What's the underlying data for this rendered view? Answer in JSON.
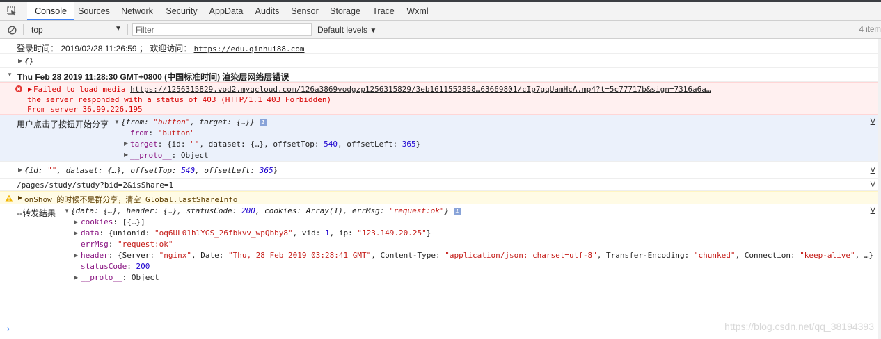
{
  "tabs": [
    "Console",
    "Sources",
    "Network",
    "Security",
    "AppData",
    "Audits",
    "Sensor",
    "Storage",
    "Trace",
    "Wxml"
  ],
  "toolbar": {
    "context": "top",
    "filter_placeholder": "Filter",
    "levels": "Default levels",
    "items_count": "4 item"
  },
  "logs": {
    "login": {
      "text": "登录时间：  2019/02/28 11:26:59 ；  欢迎访问：  ",
      "url": "https://edu.qinhui88.com"
    },
    "empty_obj": "{}",
    "group_header": "Thu Feb 28 2019 11:28:30 GMT+0800 (中国标准时间) 渲染层网络层错误",
    "error": {
      "line1_prefix": "Failed to load media ",
      "line1_url": "https://1256315829.vod2.myqcloud.com/126a3869vodgzp1256315829/3eb1611552858…63669801/cIp7gqUamHcA.mp4?t=5c77717b&sign=7316a6a…",
      "line2": "the server responded with a status of 403 (HTTP/1.1 403 Forbidden)",
      "line3": "From server 36.99.226.195"
    },
    "share_click": {
      "label": "用户点击了按钮开始分享",
      "obj_open": "{from: ",
      "obj_from_val": "\"button\"",
      "obj_mid": ", target: {…}}",
      "from_key": "from",
      "from_val": "\"button\"",
      "target_key": "target",
      "target_pre": ": {id: ",
      "target_id": "\"\"",
      "target_mid": ", dataset: {…}, offsetTop: ",
      "target_top": "540",
      "target_mid2": ", offsetLeft: ",
      "target_left": "365",
      "target_end": "}",
      "proto_key": "__proto__",
      "proto_val": ": Object"
    },
    "target_obj": {
      "pre": "{id: ",
      "id": "\"\"",
      "mid": ", dataset: {…}, offsetTop: ",
      "top": "540",
      "mid2": ", offsetLeft: ",
      "left": "365",
      "end": "}"
    },
    "path": "/pages/study/study?bid=2&isShare=1",
    "warn": {
      "text": "onShow 的时候不是群分享，清空 Global.lastShareInfo"
    },
    "forward": {
      "label": "--转发结果",
      "summary_pre": "{data: {…}, header: {…}, statusCode: ",
      "summary_code": "200",
      "summary_mid": ", cookies: Array(1), errMsg: ",
      "summary_msg": "\"request:ok\"",
      "summary_end": "}",
      "cookies_key": "cookies",
      "cookies_val": ": [{…}]",
      "data_key": "data",
      "data_pre": ": {unionid: ",
      "data_unionid": "\"oq6UL01hlYGS_26fbkvv_wpQbby8\"",
      "data_mid": ", vid: ",
      "data_vid": "1",
      "data_mid2": ", ip: ",
      "data_ip": "\"123.149.20.25\"",
      "data_end": "}",
      "errmsg_key": "errMsg",
      "errmsg_val": "\"request:ok\"",
      "header_key": "header",
      "header_pre": ": {Server: ",
      "header_server": "\"nginx\"",
      "header_mid": ", Date: ",
      "header_date": "\"Thu, 28 Feb 2019 03:28:41 GMT\"",
      "header_mid2": ", Content-Type: ",
      "header_ct": "\"application/json; charset=utf-8\"",
      "header_mid3": ", Transfer-Encoding: ",
      "header_te": "\"chunked\"",
      "header_mid4": ", Connection: ",
      "header_conn": "\"keep-alive\"",
      "header_end": ", …}",
      "status_key": "statusCode",
      "status_val": "200",
      "proto_key": "__proto__",
      "proto_val": ": Object"
    },
    "source_label": "V"
  },
  "watermark": "https://blog.csdn.net/qq_38194393"
}
